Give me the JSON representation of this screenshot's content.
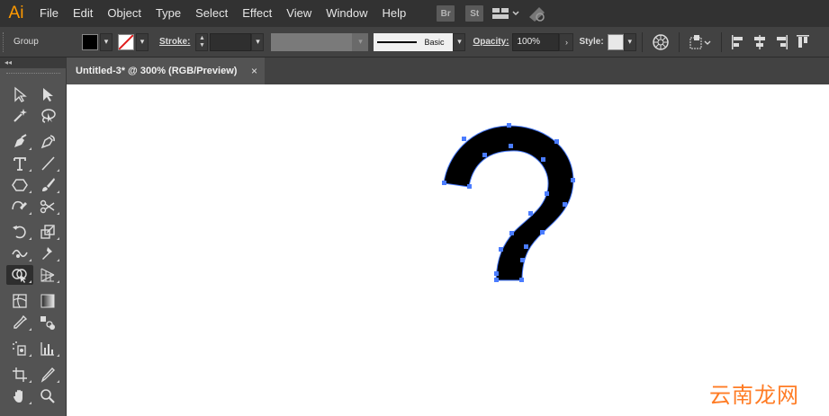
{
  "app": {
    "logo": "Ai"
  },
  "menu": [
    "File",
    "Edit",
    "Object",
    "Type",
    "Select",
    "Effect",
    "View",
    "Window",
    "Help"
  ],
  "app_icons": {
    "bridge": "Br",
    "stock": "St"
  },
  "control_bar": {
    "selection_label": "Group",
    "stroke_label": "Stroke:",
    "stroke_profile": "Basic",
    "opacity_label": "Opacity:",
    "opacity_value": "100%",
    "style_label": "Style:"
  },
  "toolbox": {
    "collapse": "◂◂"
  },
  "document": {
    "tab_title": "Untitled-3* @ 300% (RGB/Preview)",
    "close_glyph": "×"
  },
  "watermark": "云南龙网",
  "colors": {
    "fill": "#000000",
    "anchor": "#4a7cff",
    "accent": "#ff9a00"
  }
}
